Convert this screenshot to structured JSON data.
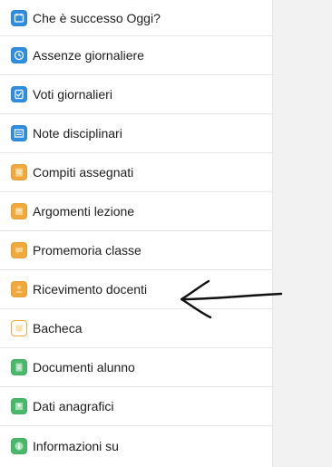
{
  "menu": {
    "items": [
      {
        "label": "Che è successo Oggi?",
        "icon": "calendar-icon",
        "color": "#2f8ee0"
      },
      {
        "label": "Assenze giornaliere",
        "icon": "clock-icon",
        "color": "#2f8ee0"
      },
      {
        "label": "Voti giornalieri",
        "icon": "grades-icon",
        "color": "#2f8ee0"
      },
      {
        "label": "Note disciplinari",
        "icon": "notes-icon",
        "color": "#2f8ee0"
      },
      {
        "label": "Compiti assegnati",
        "icon": "tasks-icon",
        "color": "#f2a93b"
      },
      {
        "label": "Argomenti lezione",
        "icon": "lessons-icon",
        "color": "#f2a93b"
      },
      {
        "label": "Promemoria classe",
        "icon": "reminder-icon",
        "color": "#f2a93b"
      },
      {
        "label": "Ricevimento docenti",
        "icon": "meeting-icon",
        "color": "#f2a93b"
      },
      {
        "label": "Bacheca",
        "icon": "board-icon",
        "color": "#f2a93b"
      },
      {
        "label": "Documenti alunno",
        "icon": "documents-icon",
        "color": "#49b86a"
      },
      {
        "label": "Dati anagrafici",
        "icon": "profile-icon",
        "color": "#49b86a"
      },
      {
        "label": "Informazioni su",
        "icon": "info-icon",
        "color": "#49b86a"
      }
    ]
  },
  "annotation": {
    "icon": "hand-drawn-arrow-icon",
    "color": "#111111"
  }
}
